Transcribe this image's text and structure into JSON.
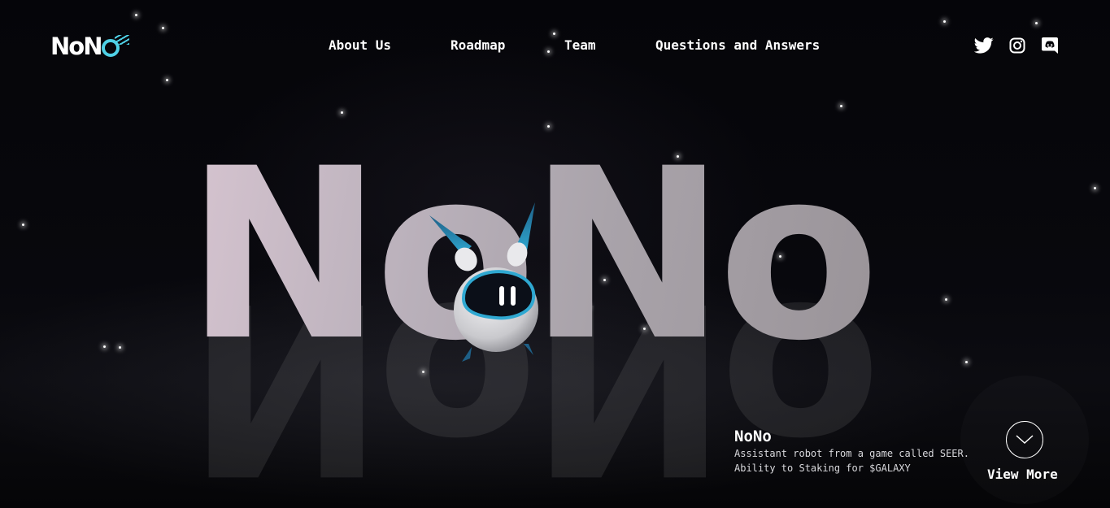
{
  "brand": {
    "logo_text": "NoN",
    "logo_accent_color": "#4fd1e6"
  },
  "nav": {
    "items": [
      {
        "label": "About Us"
      },
      {
        "label": "Roadmap"
      },
      {
        "label": "Team"
      },
      {
        "label": "Questions and Answers"
      }
    ]
  },
  "social": [
    {
      "icon": "twitter-icon"
    },
    {
      "icon": "instagram-icon"
    },
    {
      "icon": "discord-icon"
    }
  ],
  "hero": {
    "title": "NoNo"
  },
  "info": {
    "title": "NoNo",
    "lines": [
      "Assistant robot from a game called SEER.",
      "Ability to Staking for $GALAXY"
    ]
  },
  "cta": {
    "label": "View More",
    "icon": "chevron-down-icon"
  },
  "colors": {
    "background": "#07070b",
    "accent": "#4fd1e6",
    "text": "#ffffff"
  }
}
